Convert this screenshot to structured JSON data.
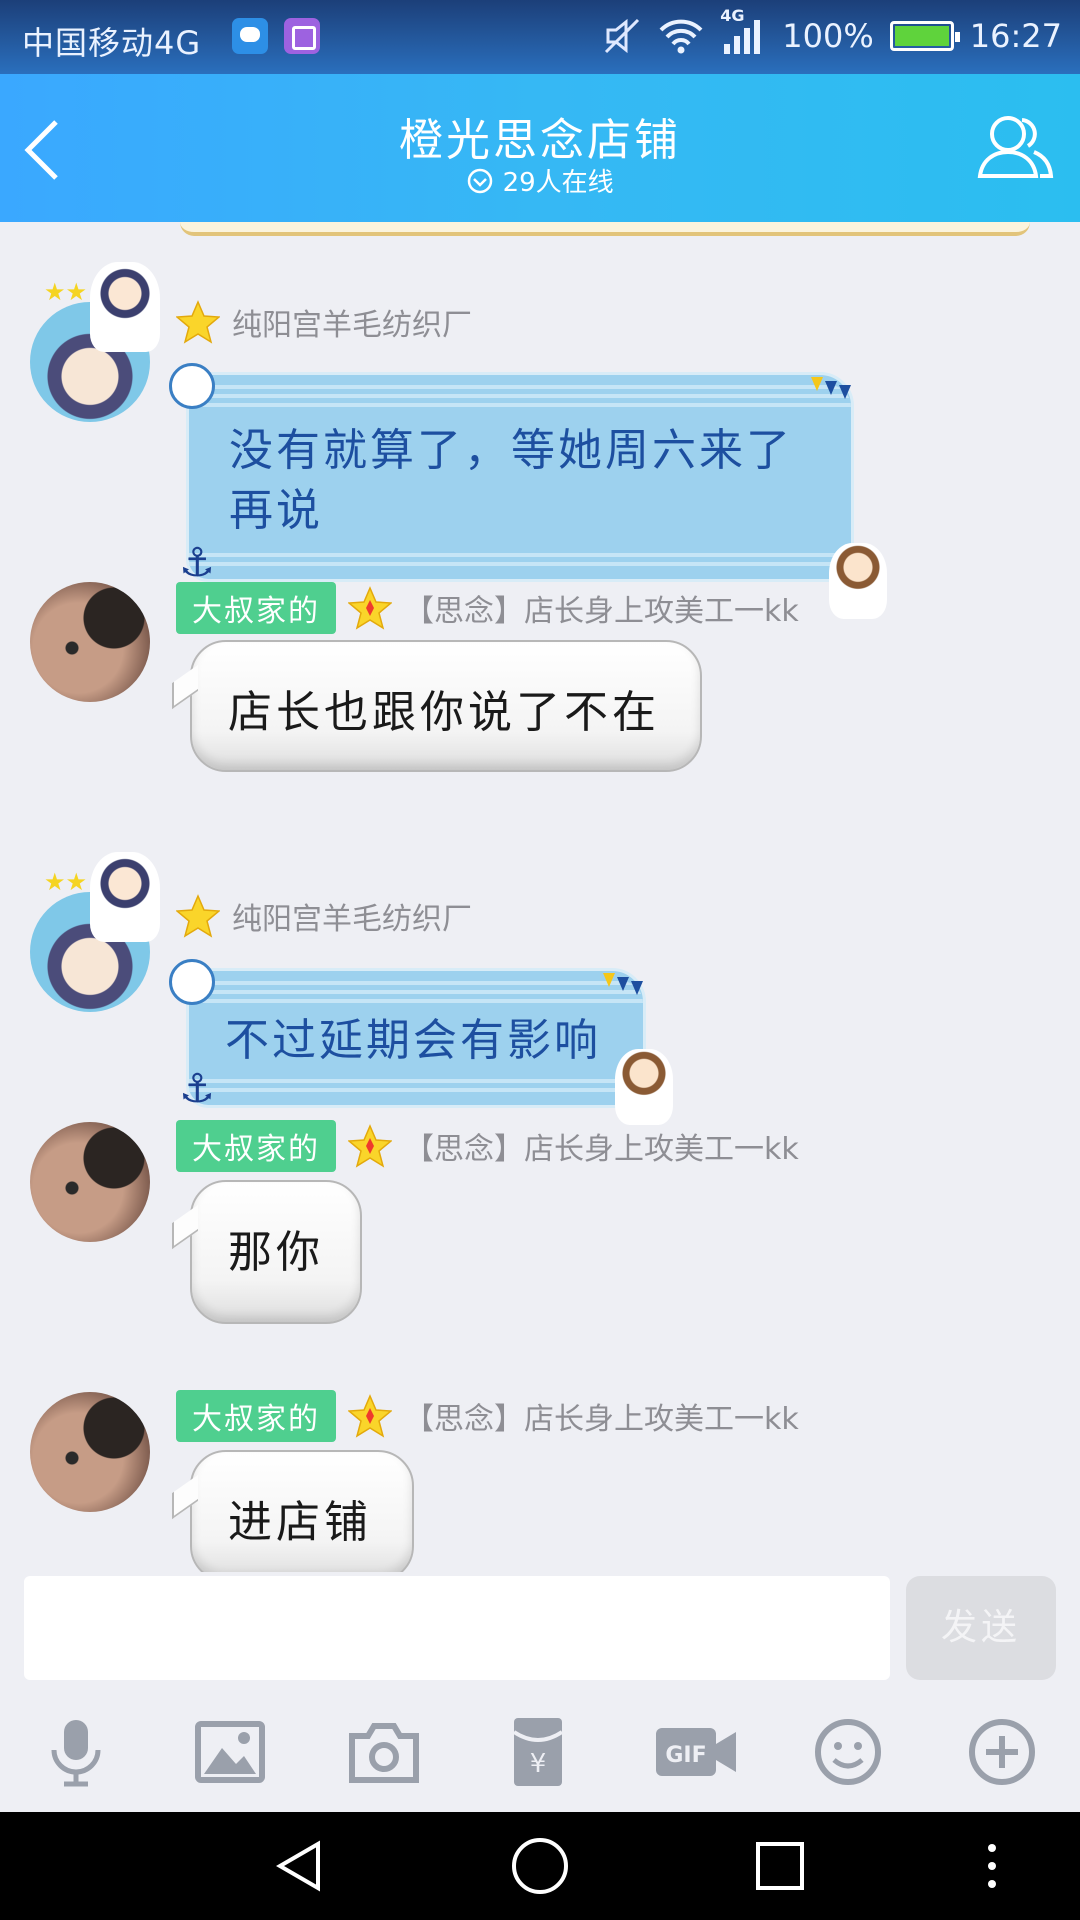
{
  "status_bar": {
    "carrier": "中国移动4G",
    "network_label": "4G",
    "battery": "100%",
    "time": "16:27"
  },
  "header": {
    "title": "橙光思念店铺",
    "online": "29人在线"
  },
  "messages": [
    {
      "sender": "纯阳宫羊毛纺织厂",
      "tag": "",
      "text_lines": [
        "没有就算了，等她周六来了",
        "再说"
      ]
    },
    {
      "sender": "【思念】店长身上攻美工一kk",
      "tag": "大叔家的",
      "text": "店长也跟你说了不在"
    },
    {
      "sender": "纯阳宫羊毛纺织厂",
      "tag": "",
      "text": "不过延期会有影响"
    },
    {
      "sender": "【思念】店长身上攻美工一kk",
      "tag": "大叔家的",
      "text": "那你"
    },
    {
      "sender": "【思念】店长身上攻美工一kk",
      "tag": "大叔家的",
      "text": "进店铺"
    }
  ],
  "input": {
    "placeholder": "",
    "send_label": "发送"
  },
  "toolbar_icons": [
    "microphone-icon",
    "image-icon",
    "camera-icon",
    "red-packet-icon",
    "gif-icon",
    "emoji-icon",
    "plus-icon"
  ],
  "colors": {
    "header": "#36b8f4",
    "tag": "#4fcf8f",
    "blue_bubble": "#9dd1ee",
    "blue_text": "#1d4fa0"
  }
}
